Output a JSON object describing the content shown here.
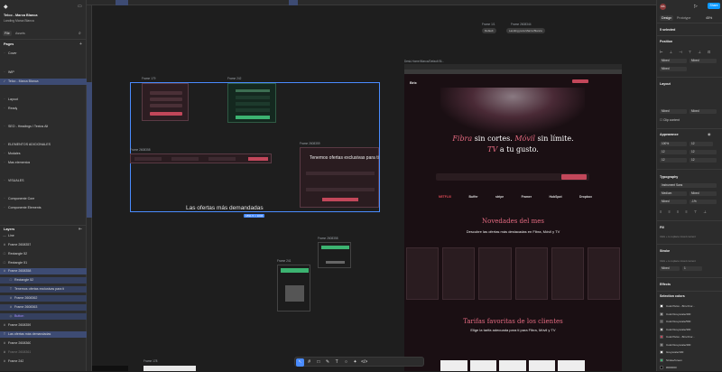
{
  "file": {
    "title": "Telco - Marca Blanca",
    "subtitle": "Landing Marca Blanca"
  },
  "left_tabs": [
    "File",
    "Assets"
  ],
  "pages": {
    "header": "Pages",
    "items": [
      "Cover",
      "WIP",
      "Telco - Marca Blanca",
      "Layout",
      "Ready",
      "SEO - Headings / Textos Alt",
      "ELEMENTOS ADICIONALES",
      "Modales",
      "Mas elementos",
      "VISUALES",
      "Componente Core",
      "Componente Elements"
    ]
  },
  "layers": {
    "header": "Layers",
    "items": [
      "Line",
      "Frame 2608357",
      "Rectangle 52",
      "Rectangle 51",
      "Frame 2608358",
      "Rectangle 52",
      "Tenemos ofertas exclusivas para ti",
      "Frame 2608362",
      "Frame 2608363",
      "Button",
      "Frame 2608359",
      "Las ofertas más demandadas",
      "Frame 2608360",
      "Frame 2608361",
      "Frame 242"
    ]
  },
  "toolbar": {
    "zoom": "45%",
    "share": "Share",
    "play": "▷",
    "avatar": "MA"
  },
  "right_tabs": [
    "Design",
    "Prototype"
  ],
  "selection": {
    "label": "5 selected"
  },
  "position": {
    "title": "Position",
    "x_label": "Mixed",
    "y_label": "Mixed",
    "rotation": "Mixed"
  },
  "layout": {
    "title": "Layout",
    "w": "Mixed",
    "h": "Mixed",
    "clip": "Clip content"
  },
  "appearance": {
    "title": "Appearance",
    "opacity": "100%",
    "radius": "12",
    "r1": "12",
    "r2": "12",
    "r3": "12",
    "r4": "12"
  },
  "typography": {
    "title": "Typography",
    "family": "Instrument Sans",
    "weight": "Medium",
    "size": "Mixed",
    "line": "Mixed",
    "letter": "-1%"
  },
  "fill": {
    "title": "Fill",
    "hint": "Click + to replace mixed content"
  },
  "stroke": {
    "title": "Stroke",
    "hint": "Click + to replace mixed content",
    "mode": "Mixed",
    "width": "1"
  },
  "effects": {
    "title": "Effects"
  },
  "selection_colors": {
    "title": "Selection colors",
    "items": [
      {
        "name": "Color/Telco - Brnc/Cor...",
        "color": "#ffffff"
      },
      {
        "name": "Color/Greyscale/400",
        "color": "#9e9e9e"
      },
      {
        "name": "Color/Greyscale/500",
        "color": "#6b6b6b"
      },
      {
        "name": "Color/Greyscale/300",
        "color": "#c4c4c4"
      },
      {
        "name": "Color/Telco - Brnc/Cor...",
        "color": "#c2475a"
      },
      {
        "name": "Color/Greyscale/400",
        "color": "#8a8a8a"
      },
      {
        "name": "Greyscale/100",
        "color": "#e8e8e8"
      },
      {
        "name": "Stroke/Green",
        "color": "#3cb371"
      },
      {
        "name": "#000000",
        "color": "#000000"
      }
    ]
  },
  "canvas": {
    "frame_labels": [
      "Frame 179",
      "Frame 242",
      "Frame 2608358",
      "Frame 2608359",
      "Frame 241",
      "Frame 2608358",
      "Desk-Home/Marca/Default Bl...",
      "Frame 1/1",
      "Frame 2608344",
      "Frame 178"
    ],
    "size_badge": "1891.5 × 1046",
    "section_title": "Las ofertas más demandadas",
    "modal_title": "Tenemos ofertas exclusivas para ti",
    "chip_left": "Default",
    "chip_right": "Landing para Marca Blanca"
  },
  "landing": {
    "logo": "Brix",
    "hero_title_1": "Fibra",
    "hero_title_2": "sin cortes.",
    "hero_title_3": "Móvil",
    "hero_title_4": "sin límite.",
    "hero_title_5": "TV",
    "hero_title_6": "a tu gusto.",
    "brands": [
      "NETFLIX",
      "Buffer",
      "stripe",
      "Framer",
      "HubSpot",
      "Dropbox"
    ],
    "novedades": "Novedades del mes",
    "novedades_sub": "Descubre las ofertas más destacadas en Fibra, Móvil y TV",
    "tarifas": "Tarifas favoritas de los clientes",
    "tarifas_sub": "Elige la tarifa adecuada para ti para Fibra, Móvil y TV"
  }
}
